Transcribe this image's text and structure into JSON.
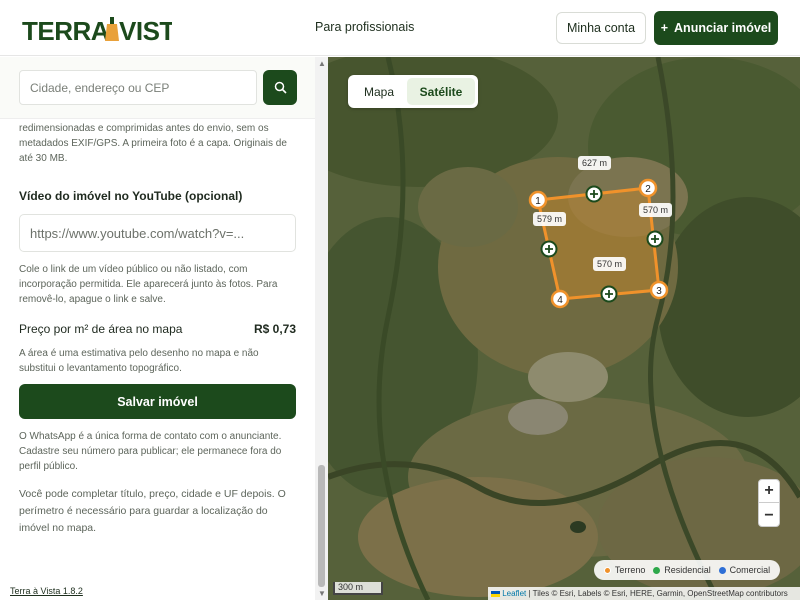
{
  "header": {
    "logo_text": "TERRA VISTA!",
    "nav_professionals": "Para profissionais",
    "account_button": "Minha conta",
    "announce_button": "Anunciar imóvel",
    "announce_icon": "+"
  },
  "sidebar": {
    "search_placeholder": "Cidade, endereço ou CEP",
    "photos_note": "redimensionadas e comprimidas antes do envio, sem os metadados EXIF/GPS. A primeira foto é a capa. Originais de até 30 MB.",
    "video_label": "Vídeo do imóvel no YouTube (opcional)",
    "video_placeholder": "https://www.youtube.com/watch?v=...",
    "video_note": "Cole o link de um vídeo público ou não listado, com incorporação permitida. Ele aparecerá junto às fotos. Para removê-lo, apague o link e salve.",
    "price_label": "Preço por m² de área no mapa",
    "price_value": "R$ 0,73",
    "area_note": "A área é uma estimativa pelo desenho no mapa e não substitui o levantamento topográfico.",
    "save_button": "Salvar imóvel",
    "whatsapp_note": "O WhatsApp é a única forma de contato com o anunciante. Cadastre seu número para publicar; ele permanece fora do perfil público.",
    "complete_note": "Você pode completar título, preço, cidade e UF depois. O perímetro é necessário para guardar a localização do imóvel no mapa.",
    "version": "Terra à Vista 1.8.2"
  },
  "map": {
    "tabs": [
      "Mapa",
      "Satélite"
    ],
    "active_tab": "Satélite",
    "vertex_labels": [
      "1",
      "2",
      "3",
      "4"
    ],
    "measurements": [
      "627 m",
      "579 m",
      "570 m",
      "570 m"
    ],
    "zoom_in": "+",
    "zoom_out": "−",
    "legend": [
      {
        "label": "Terreno",
        "color": "#f0922b"
      },
      {
        "label": "Residencial",
        "color": "#2ea84a"
      },
      {
        "label": "Comercial",
        "color": "#2f6fd6"
      }
    ],
    "scale_label": "300 m",
    "attribution_leaflet": "Leaflet",
    "attribution_rest": "| Tiles © Esri, Labels © Esri, HERE, Garmin, OpenStreetMap contributors"
  },
  "colors": {
    "brand": "#1c4a1c",
    "perimeter": "#f0922b"
  }
}
